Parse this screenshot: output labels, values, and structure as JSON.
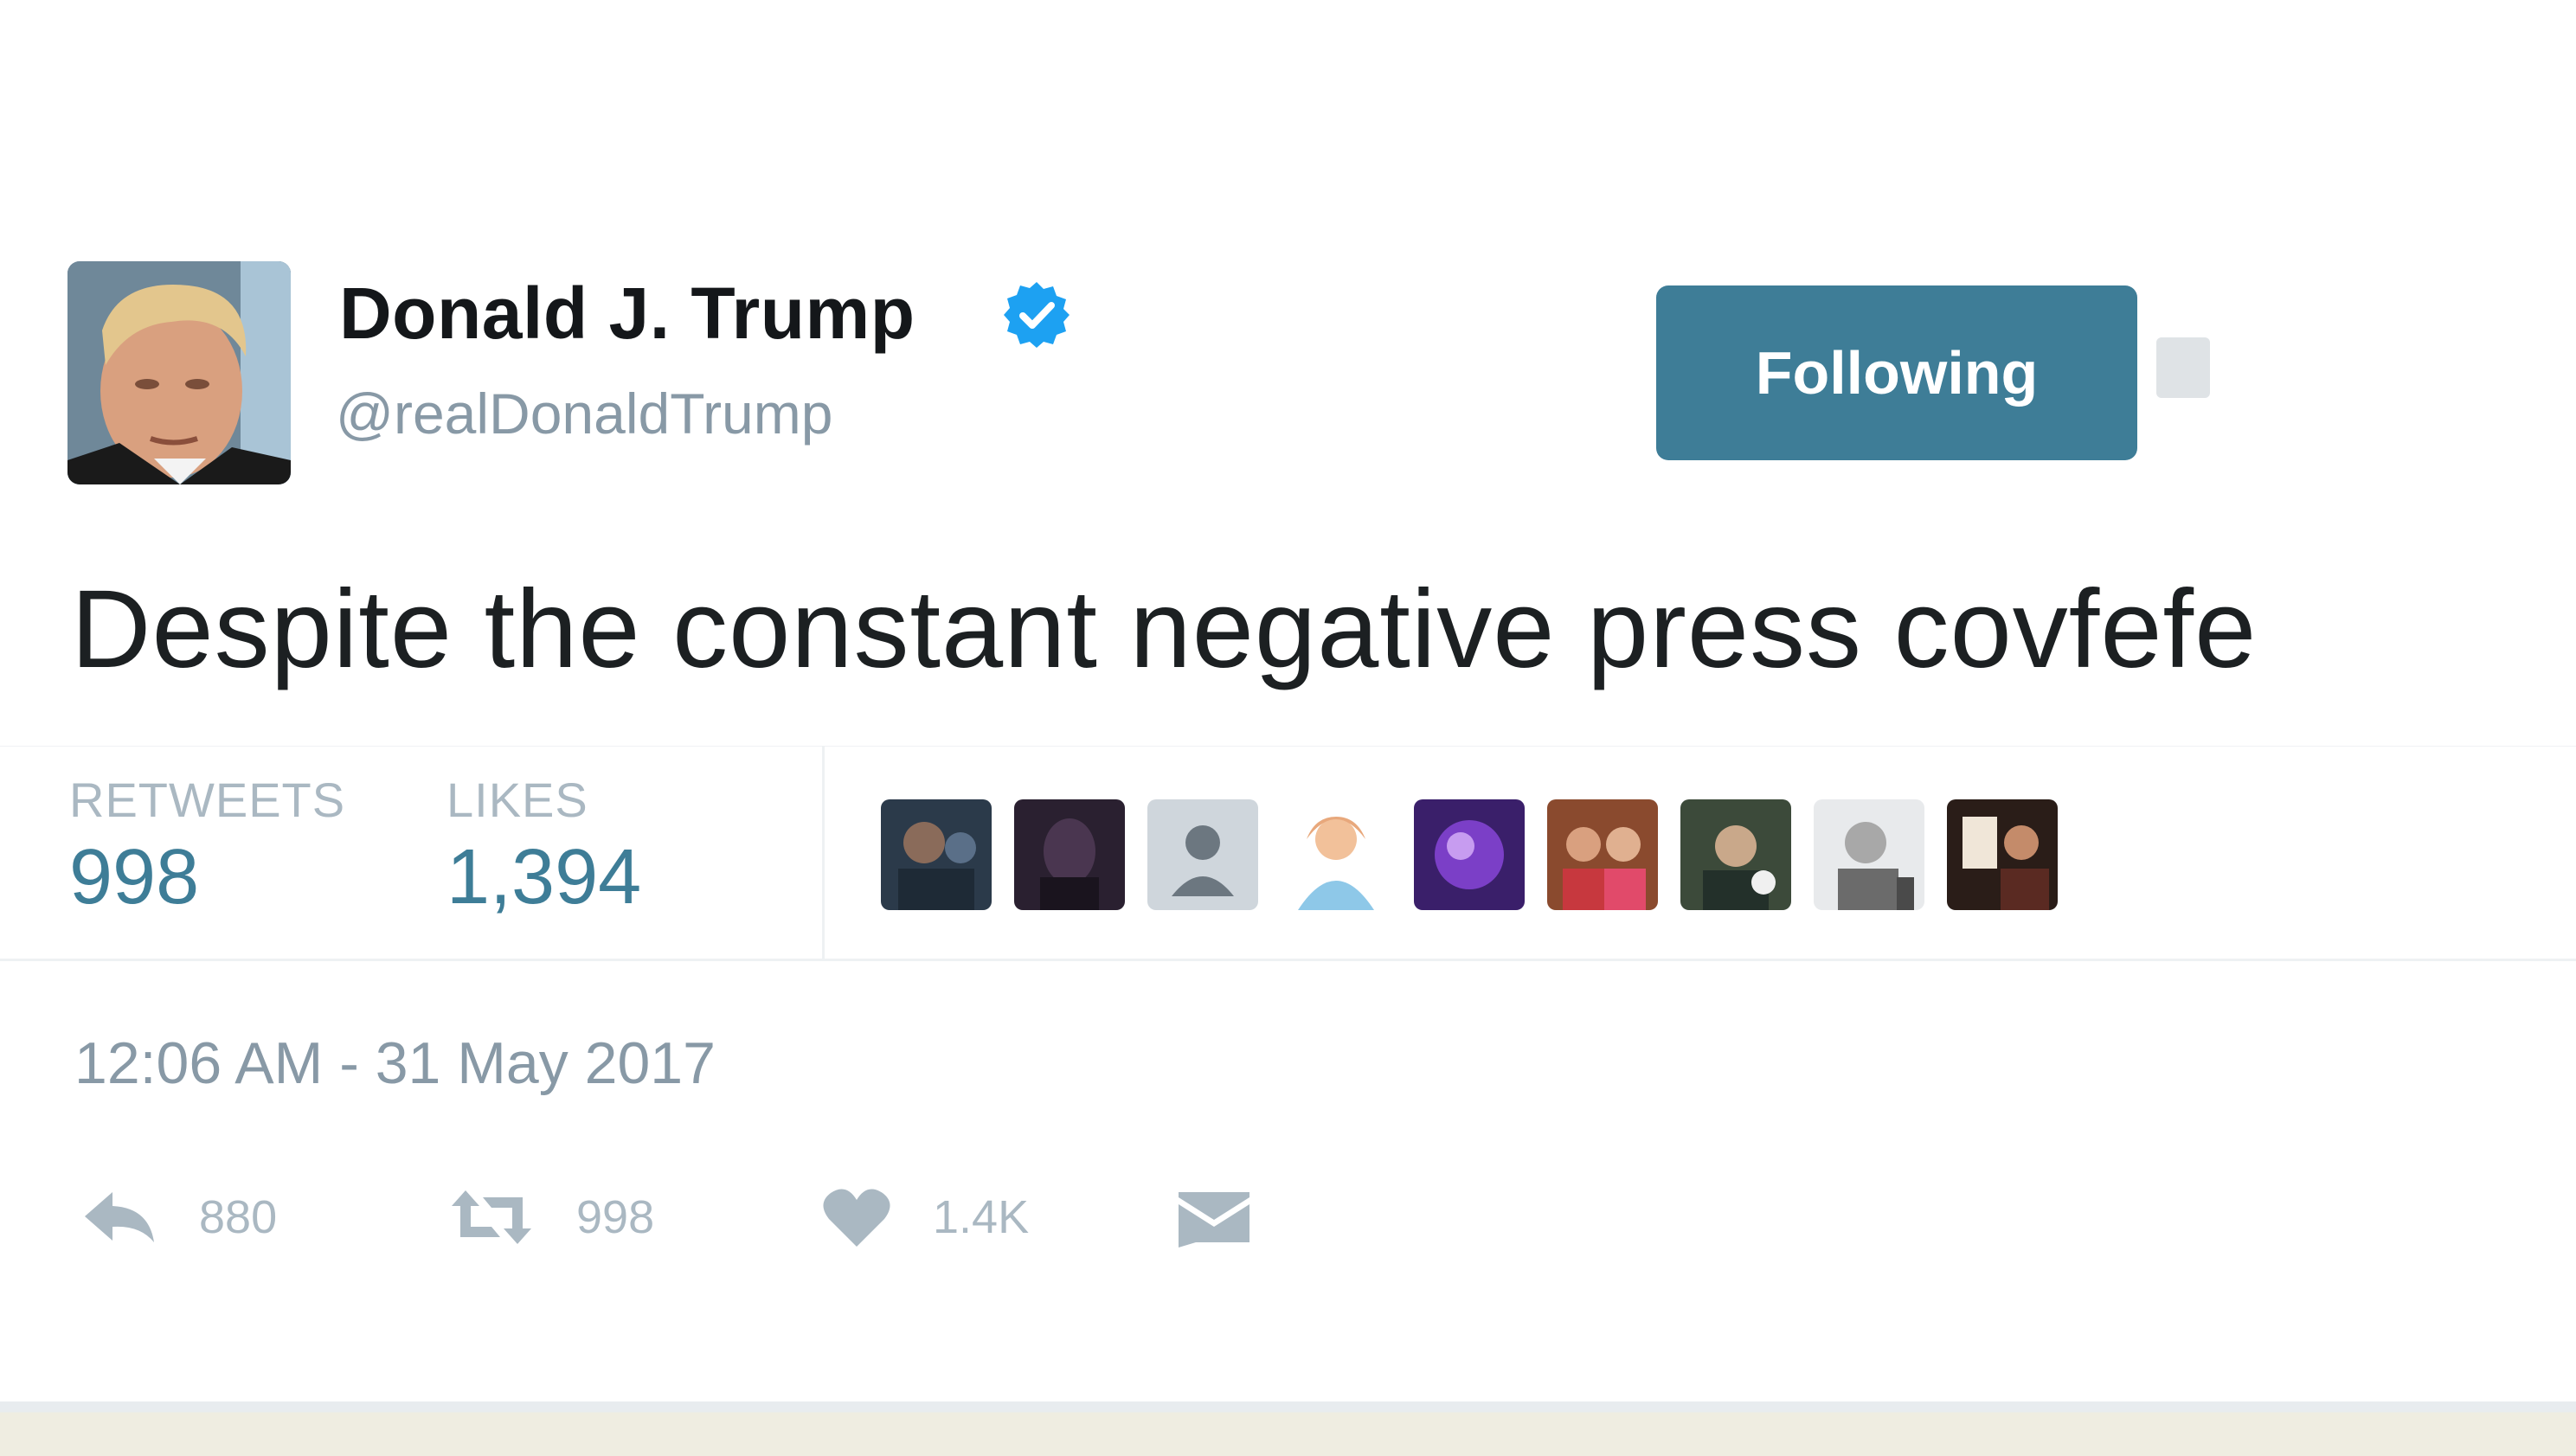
{
  "header": {
    "display_name": "Donald J. Trump",
    "handle": "@realDonaldTrump",
    "verified": true,
    "follow_button_label": "Following"
  },
  "tweet": {
    "text": "Despite the constant negative press covfefe",
    "timestamp": "12:06 AM - 31 May 2017"
  },
  "stats": {
    "retweets_label": "RETWEETS",
    "retweets_value": "998",
    "likes_label": "LIKES",
    "likes_value": "1,394"
  },
  "actions": {
    "reply_count": "880",
    "retweet_count": "998",
    "like_count": "1.4K"
  },
  "colors": {
    "accent": "#3e7d97",
    "verified_blue": "#1da1f2",
    "muted": "#8899a6",
    "icon_gray": "#aab8c2",
    "text": "#1c2022"
  },
  "icons": [
    "verified-badge-icon",
    "caret-icon",
    "reply-icon",
    "retweet-icon",
    "heart-icon",
    "direct-message-icon"
  ]
}
